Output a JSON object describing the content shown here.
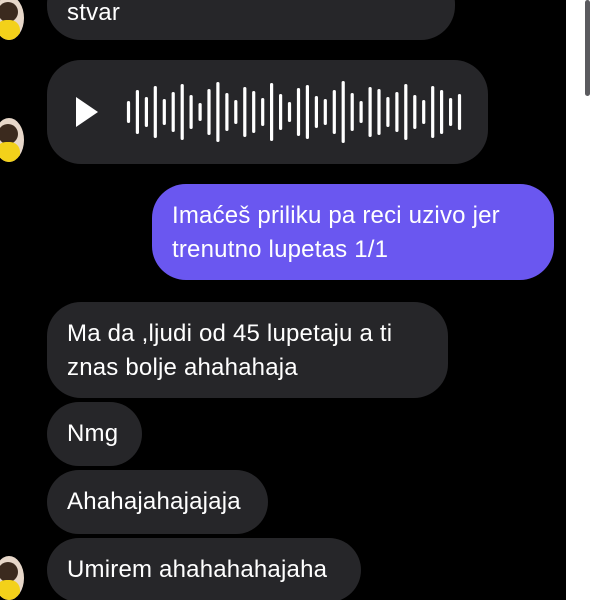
{
  "colors": {
    "background": "#000000",
    "incoming_bubble": "#262629",
    "outgoing_bubble": "#6a57f0",
    "text": "#ffffff"
  },
  "messages": [
    {
      "type": "text",
      "direction": "incoming",
      "text": "stvar"
    },
    {
      "type": "voice",
      "direction": "incoming",
      "icon": "play-icon"
    },
    {
      "type": "text",
      "direction": "outgoing",
      "text": "Imaćeš priliku pa reci uzivo jer\ntrenutno lupetas 1/1"
    },
    {
      "type": "text",
      "direction": "incoming",
      "text": "Ma da ,ljudi od 45 lupetaju a ti\nznas bolje ahahahaja"
    },
    {
      "type": "text",
      "direction": "incoming",
      "text": "Nmg"
    },
    {
      "type": "text",
      "direction": "incoming",
      "text": "Ahahajahajajaja"
    },
    {
      "type": "text",
      "direction": "incoming",
      "text": "Umirem ahahahahajaha"
    }
  ]
}
